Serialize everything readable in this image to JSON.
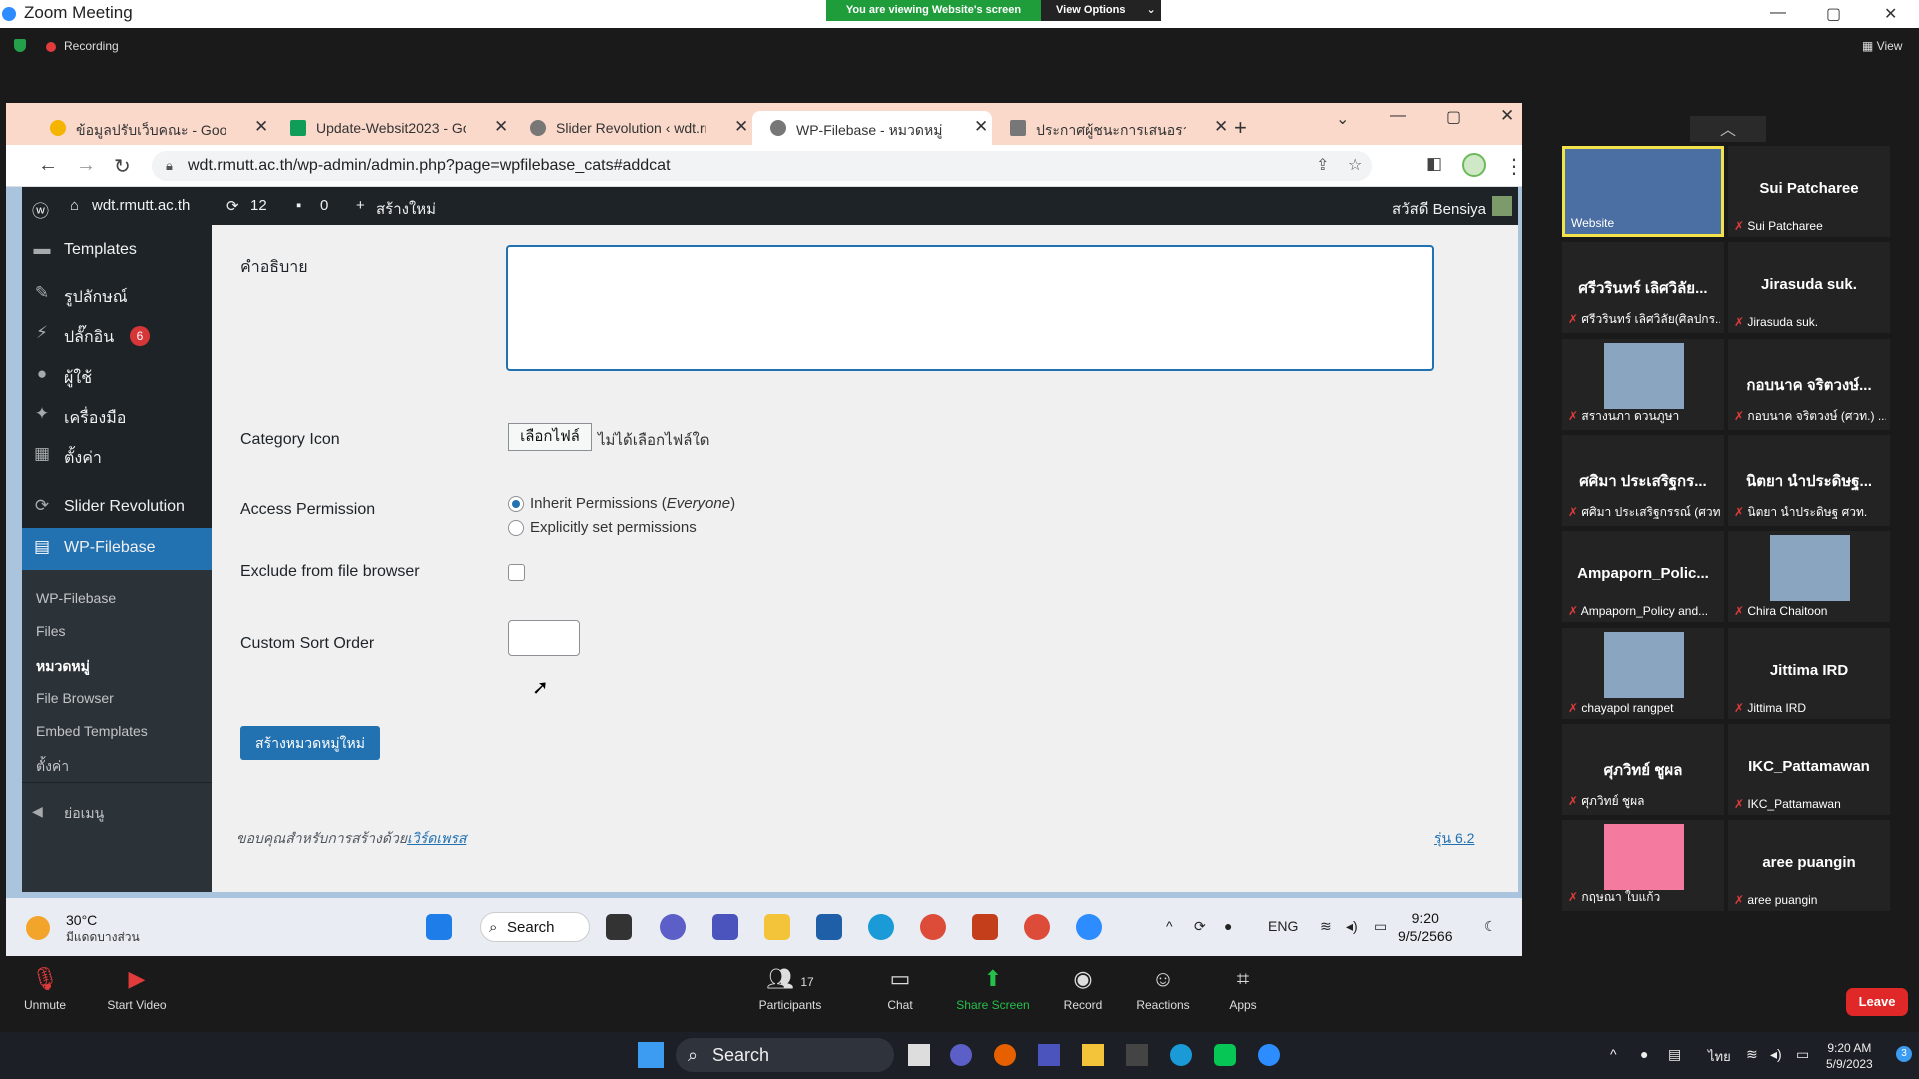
{
  "zoom": {
    "title": "Zoom Meeting",
    "banner": "You are viewing Website's screen",
    "view_options": "View Options",
    "recording": "Recording",
    "view": "View",
    "toolbar": {
      "unmute": "Unmute",
      "start_video": "Start Video",
      "participants": "Participants",
      "participants_count": "17",
      "chat": "Chat",
      "share_screen": "Share Screen",
      "record": "Record",
      "reactions": "Reactions",
      "apps": "Apps",
      "leave": "Leave"
    }
  },
  "browser": {
    "tabs": [
      {
        "label": "ข้อมูลปรับเว็บคณะ - Google",
        "color": "#f4b400"
      },
      {
        "label": "Update-Websit2023 - Go",
        "color": "#0f9d58"
      },
      {
        "label": "Slider Revolution ‹ wdt.rm",
        "color": "#777777"
      },
      {
        "label": "WP-Filebase - หมวดหมู่ ‹ w",
        "color": "#777777"
      },
      {
        "label": "ประกาศผู้ชนะการเสนอราคา",
        "color": "#777777"
      }
    ],
    "url": "wdt.rmutt.ac.th/wp-admin/admin.php?page=wpfilebase_cats#addcat"
  },
  "wpbar": {
    "site": "wdt.rmutt.ac.th",
    "updates": "12",
    "comments": "0",
    "new": "สร้างใหม่",
    "greeting": "สวัสดี Bensiya"
  },
  "sidebar": {
    "items": [
      {
        "label": "Templates"
      },
      {
        "label": "รูปลักษณ์"
      },
      {
        "label": "ปลั๊กอิน"
      },
      {
        "label": "ผู้ใช้"
      },
      {
        "label": "เครื่องมือ"
      },
      {
        "label": "ตั้งค่า"
      },
      {
        "label": "Slider Revolution"
      },
      {
        "label": "WP-Filebase"
      }
    ],
    "plugin_badge": "6",
    "submenu": [
      "WP-Filebase",
      "Files",
      "หมวดหมู่",
      "File Browser",
      "Embed Templates",
      "ตั้งค่า"
    ],
    "collapse": "ย่อเมนู"
  },
  "form": {
    "description_label": "คำอธิบาย",
    "icon_label": "Category Icon",
    "choose_file": "เลือกไฟล์",
    "no_file": "ไม่ได้เลือกไฟล์ใด",
    "access_label": "Access Permission",
    "radio_inherit_a": "Inherit Permissions (",
    "radio_inherit_b": "Everyone",
    "radio_inherit_c": ")",
    "radio_explicit": "Explicitly set permissions",
    "exclude_label": "Exclude from file browser",
    "sort_label": "Custom Sort Order",
    "submit": "สร้างหมวดหมู่ใหม่",
    "footer_a": "ขอบคุณสำหรับการสร้างด้วย",
    "footer_link": "เวิร์ดเพรส",
    "version": "รุ่น 6.2"
  },
  "share_taskbar": {
    "temp": "30°C",
    "weather": "มีแดดบางส่วน",
    "search": "Search",
    "lang": "ENG",
    "time": "9:20",
    "date": "9/5/2566"
  },
  "participants": [
    {
      "big": "",
      "small": "Website",
      "video": true
    },
    {
      "big": "Sui Patcharee",
      "small": "Sui Patcharee"
    },
    {
      "big": "ศรีวรินทร์ เลิศวิลัย...",
      "small": "ศรีวรินทร์ เลิศวิลัย(ศิลปกร..."
    },
    {
      "big": "Jirasuda suk.",
      "small": "Jirasuda suk."
    },
    {
      "big": "",
      "small": "สรางนภา ดวนภูษา",
      "video": true
    },
    {
      "big": "กอบนาค จริตวงษ์...",
      "small": "กอบนาค จริตวงษ์ (ศวท.) ..."
    },
    {
      "big": "ศศิมา ประเสริฐกร...",
      "small": "ศศิมา ประเสริฐกรรณ์ (ศวท)"
    },
    {
      "big": "นิตยา นำประดิษฐ...",
      "small": "นิตยา นำประดิษฐ ศวท."
    },
    {
      "big": "Ampaporn_Polic...",
      "small": "Ampaporn_Policy and..."
    },
    {
      "big": "",
      "small": "Chira Chaitoon",
      "video": true
    },
    {
      "big": "",
      "small": "chayapol rangpet",
      "video": true
    },
    {
      "big": "Jittima IRD",
      "small": "Jittima IRD"
    },
    {
      "big": "ศุภวิทย์ ชูผล",
      "small": "ศุภวิทย์ ชูผล"
    },
    {
      "big": "IKC_Pattamawan",
      "small": "IKC_Pattamawan"
    },
    {
      "big": "",
      "small": "กฤษณา ใบแก้ว",
      "video": true
    },
    {
      "big": "aree puangin",
      "small": "aree puangin"
    }
  ],
  "windows_taskbar": {
    "search": "Search",
    "lang": "ไทย",
    "time": "9:20 AM",
    "date": "5/9/2023",
    "notif": "3"
  }
}
